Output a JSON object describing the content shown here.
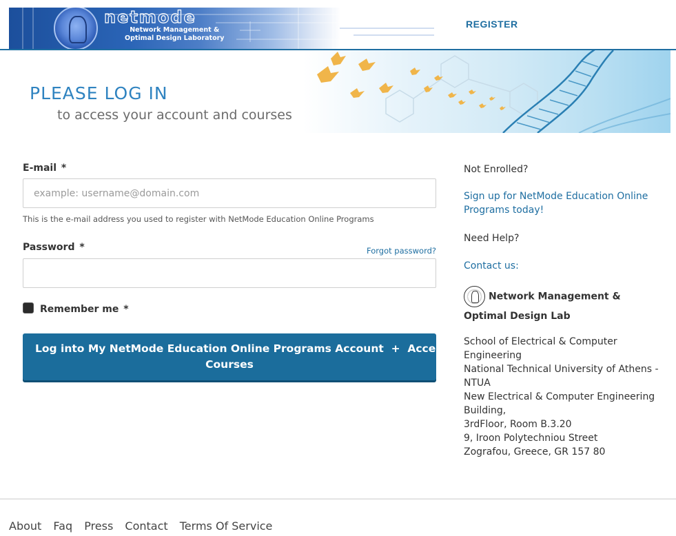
{
  "header": {
    "logo_word": "netmode",
    "logo_sub_line1": "Network Management &",
    "logo_sub_line2": "Optimal Design Laboratory",
    "register_label": "REGISTER"
  },
  "hero": {
    "title": "PLEASE LOG IN",
    "subtitle": "to access your account and courses"
  },
  "form": {
    "email_label": "E-mail",
    "required_mark": "*",
    "email_placeholder": "example: username@domain.com",
    "email_value": "",
    "email_help": "This is the e-mail address you used to register with NetMode Education Online Programs",
    "password_label": "Password",
    "forgot_password": "Forgot password?",
    "password_value": "",
    "remember_label": "Remember me",
    "remember_checked": false,
    "login_button_line1": "Log into My NetMode Education Online Programs Account  +  Access My",
    "login_button_line2": "Courses"
  },
  "sidebar": {
    "not_enrolled": "Not Enrolled?",
    "signup_link": "Sign up for NetMode Education Online Programs today!",
    "need_help": "Need Help?",
    "contact_link": "Contact us:",
    "lab_name": "Network Management & Optimal Design Lab",
    "address": [
      "School of Electrical & Computer Engineering",
      "National Technical University of Athens - NTUA",
      "New Electrical & Computer Engineering Building,",
      "3rdFloor, Room B.3.20",
      "9, Iroon Polytechniou Street",
      "Zografou, Greece, GR 157 80"
    ]
  },
  "footer": {
    "links": [
      "About",
      "Faq",
      "Press",
      "Contact",
      "Terms Of Service"
    ]
  },
  "colors": {
    "accent": "#1e6ea1",
    "button": "#1b6d9c",
    "hero_title": "#2f83c0"
  }
}
